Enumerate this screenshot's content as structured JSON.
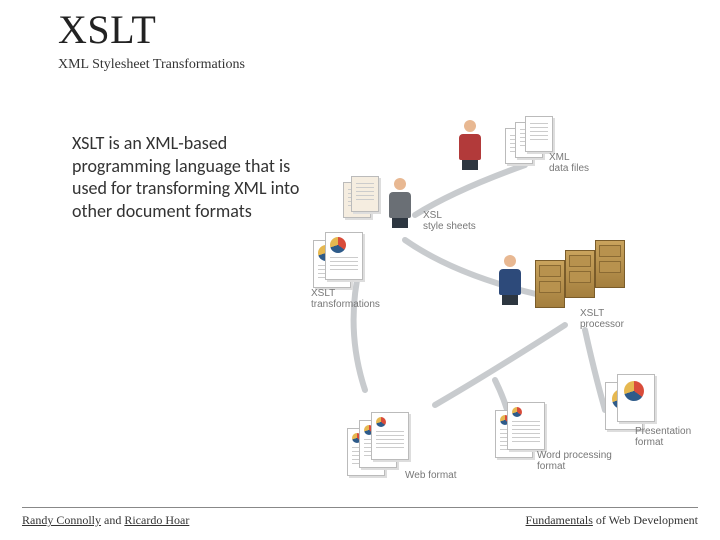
{
  "title": "XSLT",
  "subtitle": "XML Stylesheet Transformations",
  "body": "XSLT is an XML-based programming language that is used for transforming XML into other document formats",
  "footer": {
    "left_1": "Randy Connolly",
    "left_mid": " and ",
    "left_2": "Ricardo Hoar",
    "right_1": "Fundamentals",
    "right_2": " of Web Development"
  },
  "diagram_labels": {
    "xml_data": "XML\ndata files",
    "xsl_sheets": "XSL\nstyle sheets",
    "xslt_trans": "XSLT\ntransformations",
    "xslt_proc": "XSLT\nprocessor",
    "presentation": "Presentation\nformat",
    "wordproc": "Word processing\nformat",
    "web": "Web format"
  }
}
